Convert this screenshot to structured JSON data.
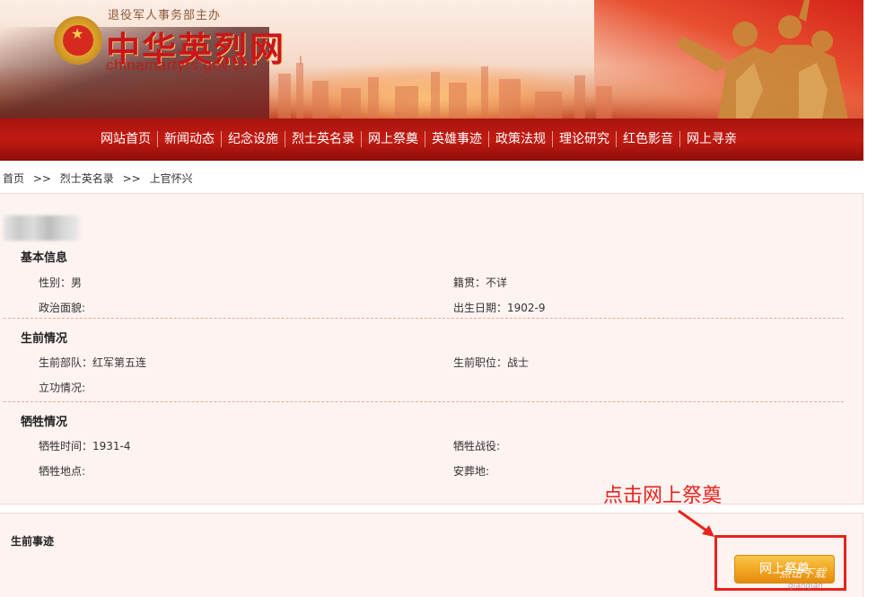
{
  "header": {
    "sponsor": "退役军人事务部主办",
    "title": "中华英烈网",
    "domain": "chinamartyrs.gov.cn"
  },
  "nav": {
    "items": [
      "网站首页",
      "新闻动态",
      "纪念设施",
      "烈士英名录",
      "网上祭奠",
      "英雄事迹",
      "政策法规",
      "理论研究",
      "红色影音",
      "网上寻亲"
    ]
  },
  "breadcrumb": {
    "home": "首页",
    "sep1": ">>",
    "list": "烈士英名录",
    "sep2": ">>",
    "current": "上官怀兴"
  },
  "basic": {
    "title": "基本信息",
    "gender": "性别：男",
    "origin": "籍贯：不详",
    "politics": "政治面貌:",
    "birth": "出生日期：1902-9"
  },
  "life": {
    "title": "生前情况",
    "unit": "生前部队：红军第五连",
    "post": "生前职位：战士",
    "merit": "立功情况:"
  },
  "sacrifice": {
    "title": "牺牲情况",
    "time": "牺牲时间：1931-4",
    "battle": "牺牲战役:",
    "place": "牺牲地点:",
    "burial": "安葬地:"
  },
  "story": {
    "title": "生前事迹"
  },
  "tribute_button": "网上祭奠",
  "annotation": "点击网上祭奠",
  "watermark": "点击下载",
  "watermark_sub": "qianqian",
  "colors": {
    "nav_red": "#b3160f",
    "annotation_red": "#e8231d",
    "button_orange": "#f0a21e",
    "panel_bg": "#fdf3f1"
  }
}
